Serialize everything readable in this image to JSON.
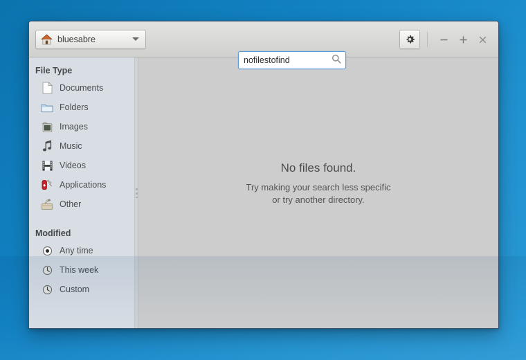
{
  "window": {
    "path_button": {
      "label": "bluesabre",
      "icon": "home-icon",
      "dropdown_icon": "chevron-down-icon"
    },
    "search": {
      "value": "nofilestofind",
      "placeholder": "Search",
      "icon": "search-icon"
    },
    "toolbar": {
      "settings_icon": "gear-icon",
      "minimize_label": "−",
      "maximize_label": "+",
      "close_label": "×"
    }
  },
  "sidebar": {
    "file_type": {
      "title": "File Type",
      "items": [
        {
          "label": "Documents",
          "icon": "document-icon"
        },
        {
          "label": "Folders",
          "icon": "folder-icon"
        },
        {
          "label": "Images",
          "icon": "image-icon"
        },
        {
          "label": "Music",
          "icon": "music-note-icon"
        },
        {
          "label": "Videos",
          "icon": "film-strip-icon"
        },
        {
          "label": "Applications",
          "icon": "swiss-knife-icon"
        },
        {
          "label": "Other",
          "icon": "toolbox-icon"
        }
      ]
    },
    "modified": {
      "title": "Modified",
      "items": [
        {
          "label": "Any time",
          "icon": "radio-selected-icon",
          "selected": true
        },
        {
          "label": "This week",
          "icon": "clock-icon",
          "selected": false
        },
        {
          "label": "Custom",
          "icon": "clock-icon",
          "selected": false
        }
      ]
    }
  },
  "content": {
    "empty_state": {
      "title": "No files found.",
      "line1": "Try making your search less specific",
      "line2": "or try another directory."
    }
  },
  "colors": {
    "desktop_blue": "#1383c4",
    "sidebar_bg": "#d9dee5",
    "content_bg": "#cdcdcd",
    "titlebar_bg": "#dcdcda",
    "focus_border": "#5b9ad8",
    "text": "#4a4e52"
  }
}
